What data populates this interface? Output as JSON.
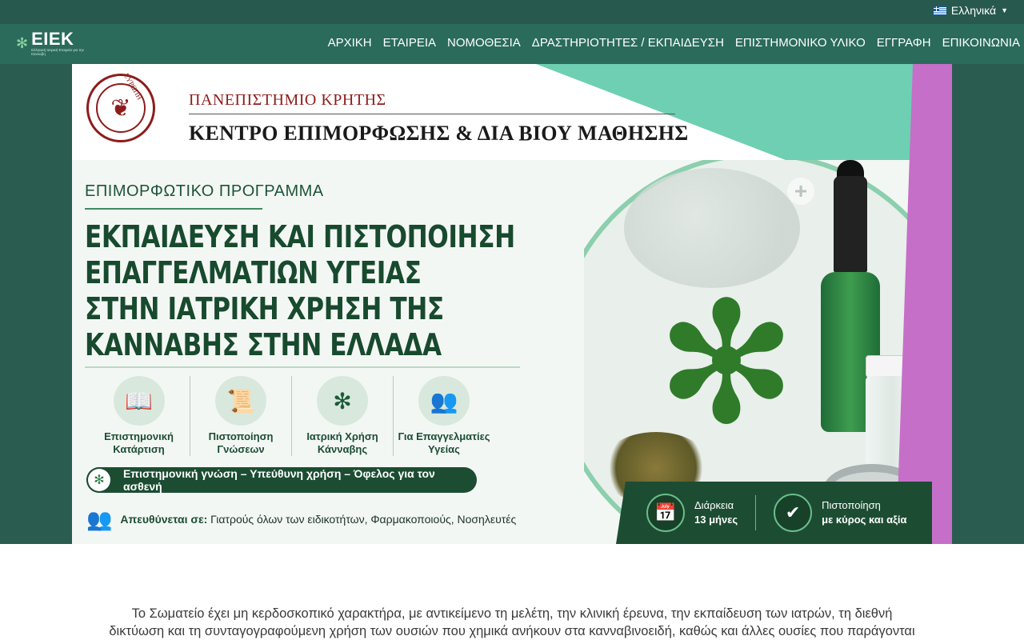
{
  "topbar": {
    "language_label": "Ελληνικά"
  },
  "nav": {
    "logo_text": "ΕΙΕΚ",
    "logo_subtitle": "Ελληνική Ιατρική Εταιρεία για την Κανναβη",
    "items": [
      {
        "label": "ΑΡΧΙΚΗ"
      },
      {
        "label": "ΕΤΑΙΡΕΙΑ"
      },
      {
        "label": "ΝΟΜΟΘΕΣΙΑ"
      },
      {
        "label": "ΔΡΑΣΤΗΡΙΟΤΗΤΕΣ / ΕΚΠΑΙΔΕΥΣΗ"
      },
      {
        "label": "ΕΠΙΣΤΗΜΟΝΙΚΟ ΥΛΙΚΟ"
      },
      {
        "label": "ΕΓΓΡΑΦΗ"
      },
      {
        "label": "ΕΠΙΚΟΙΝΩΝΙΑ"
      }
    ]
  },
  "banner": {
    "seal_text": "ΕΥΡΩΠΗ",
    "university": "ΠΑΝΕΠΙΣΤΗΜΙΟ ΚΡΗΤΗΣ",
    "center": "ΚΕΝΤΡΟ ΕΠΙΜΟΡΦΩΣΗΣ & ΔΙΑ ΒΙΟΥ ΜΑΘΗΣΗΣ",
    "program_label": "ΕΠΙΜΟΡΦΩΤΙΚΟ ΠΡΟΓΡΑΜΜΑ",
    "title_lines": [
      "ΕΚΠΑΙΔΕΥΣΗ ΚΑΙ ΠΙΣΤΟΠΟΙΗΣΗ",
      "ΕΠΑΓΓΕΛΜΑΤΙΩΝ ΥΓΕΙΑΣ",
      "ΣΤΗΝ ΙΑΤΡΙΚΗ ΧΡΗΣΗ ΤΗΣ",
      "ΚΑΝΝΑΒΗΣ ΣΤΗΝ ΕΛΛΑΔΑ"
    ],
    "features": [
      {
        "line1": "Επιστημονική",
        "line2": "Κατάρτιση",
        "icon": "book-icon"
      },
      {
        "line1": "Πιστοποίηση",
        "line2": "Γνώσεων",
        "icon": "certificate-icon"
      },
      {
        "line1": "Ιατρική Χρήση",
        "line2": "Κάνναβης",
        "icon": "cannabis-leaf-icon"
      },
      {
        "line1": "Για Επαγγελματίες",
        "line2": "Υγείας",
        "icon": "people-icon"
      }
    ],
    "tagline": "Επιστημονική γνώση – Υπεύθυνη χρήση – Όφελος για τον ασθενή",
    "audience_label": "Απευθύνεται σε:",
    "audience_text": "Γιατρούς όλων των ειδικοτήτων, Φαρμακοποιούς, Νοσηλευτές",
    "duration_label": "Διάρκεια",
    "duration_value": "13 μήνες",
    "cert_label": "Πιστοποίηση",
    "cert_value": "με κύρος και αξία"
  },
  "intro": {
    "line1": "Το Σωματείο έχει μη κερδοσκοπικό χαρακτήρα, με αντικείμενο τη μελέτη, την κλινική έρευνα, την εκπαίδευση των ιατρών, τη διεθνή",
    "line2": "δικτύωση και τη συνταγογραφούμενη χρήση των ουσιών που χημικά ανήκουν στα κανναβινοειδή, καθώς και άλλες ουσίες που παράγονται"
  },
  "colors": {
    "topbar": "#27594f",
    "navbar": "#2a6b5b",
    "hero_bg": "#2b5c50",
    "dark_green": "#1c4d33",
    "teal": "#6ecfb2",
    "purple": "#c66fc8",
    "seal_red": "#8e1c1c"
  }
}
